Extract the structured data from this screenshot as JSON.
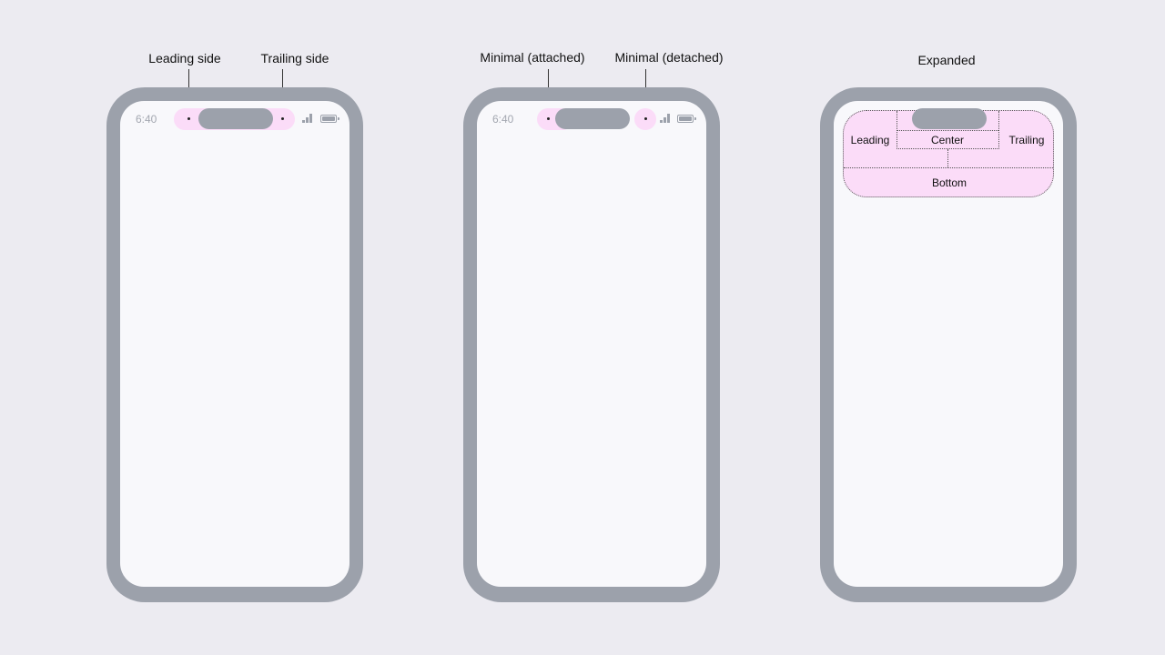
{
  "diagrams": [
    {
      "title": "",
      "status_bar": {
        "time": "6:40",
        "signal_icon": "cellular-signal-icon",
        "battery_icon": "battery-icon"
      },
      "callouts": [
        {
          "label": "Leading side"
        },
        {
          "label": "Trailing side"
        }
      ],
      "presentation": "compact"
    },
    {
      "title": "",
      "status_bar": {
        "time": "6:40",
        "signal_icon": "cellular-signal-icon",
        "battery_icon": "battery-icon"
      },
      "callouts": [
        {
          "label": "Minimal (attached)"
        },
        {
          "label": "Minimal (detached)"
        }
      ],
      "presentation": "minimal"
    },
    {
      "title": "Expanded",
      "regions": {
        "leading": "Leading",
        "center": "Center",
        "trailing": "Trailing",
        "bottom": "Bottom"
      },
      "presentation": "expanded"
    }
  ],
  "colors": {
    "background": "#ecebf1",
    "device_frame": "#9ca1ab",
    "screen": "#f8f8fb",
    "island_highlight": "#fbdcf8"
  }
}
